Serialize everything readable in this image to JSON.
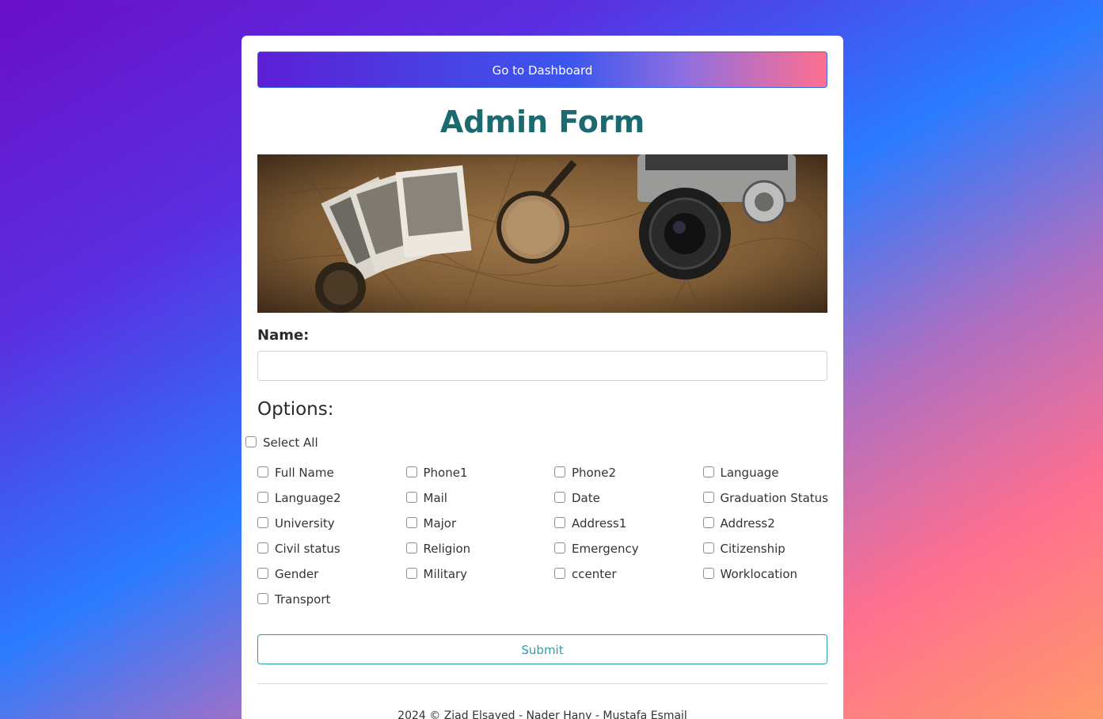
{
  "header": {
    "dashboard_button": "Go to Dashboard",
    "title": "Admin Form"
  },
  "hero_image": {
    "description_icon": "vintage-travel-photo"
  },
  "form": {
    "name_label": "Name:",
    "name_value": "",
    "options_heading": "Options:",
    "select_all_label": "Select All",
    "options": [
      "Full Name",
      "Phone1",
      "Phone2",
      "Language",
      "Language2",
      "Mail",
      "Date",
      "Graduation Status",
      "University",
      "Major",
      "Address1",
      "Address2",
      "Civil status",
      "Religion",
      "Emergency",
      "Citizenship",
      "Gender",
      "Military",
      "ccenter",
      "Worklocation",
      "Transport"
    ],
    "submit_label": "Submit"
  },
  "footer": {
    "text": "2024 © Ziad Elsayed - Nader Hany - Mustafa Esmail"
  },
  "colors": {
    "title": "#1b6a70",
    "submit_accent": "#2aa0a8"
  }
}
